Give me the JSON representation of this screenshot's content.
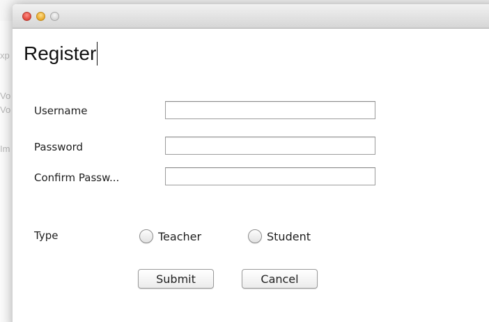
{
  "background_window": {
    "fragments": [
      "xp",
      "Vo",
      "Vo",
      "Im"
    ]
  },
  "window": {
    "title": ""
  },
  "form": {
    "heading": "Register",
    "username_label": "Username",
    "username_value": "",
    "password_label": "Password",
    "password_value": "",
    "confirm_password_label": "Confirm Passw...",
    "confirm_password_value": "",
    "type_label": "Type",
    "type_options": [
      "Teacher",
      "Student"
    ],
    "type_selected": null,
    "submit_label": "Submit",
    "cancel_label": "Cancel"
  }
}
